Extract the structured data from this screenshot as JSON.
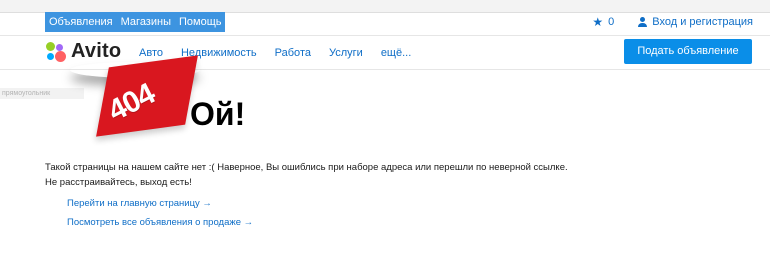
{
  "topnav": {
    "items": [
      "Объявления",
      "Магазины",
      "Помощь"
    ]
  },
  "user": {
    "favorites_count": "0",
    "login_label": "Вход и регистрация"
  },
  "logo": {
    "text": "Avito"
  },
  "categories": [
    "Авто",
    "Недвижимость",
    "Работа",
    "Услуги",
    "ещё..."
  ],
  "post_button": "Подать объявление",
  "error": {
    "grey_label": "прямоугольник",
    "code": "404",
    "headline": "Ой!",
    "message_line1": "Такой страницы на нашем сайте нет :( Наверное, Вы ошиблись при наборе адреса или перешли по неверной ссылке.",
    "message_line2": "Не расстраивайтесь, выход есть!"
  },
  "links": [
    "Перейти на главную страницу →",
    "Посмотреть все объявления о продаже →"
  ],
  "colors": {
    "accent": "#0a8ee8",
    "link": "#0f6ec7",
    "banner": "#d9171f"
  }
}
